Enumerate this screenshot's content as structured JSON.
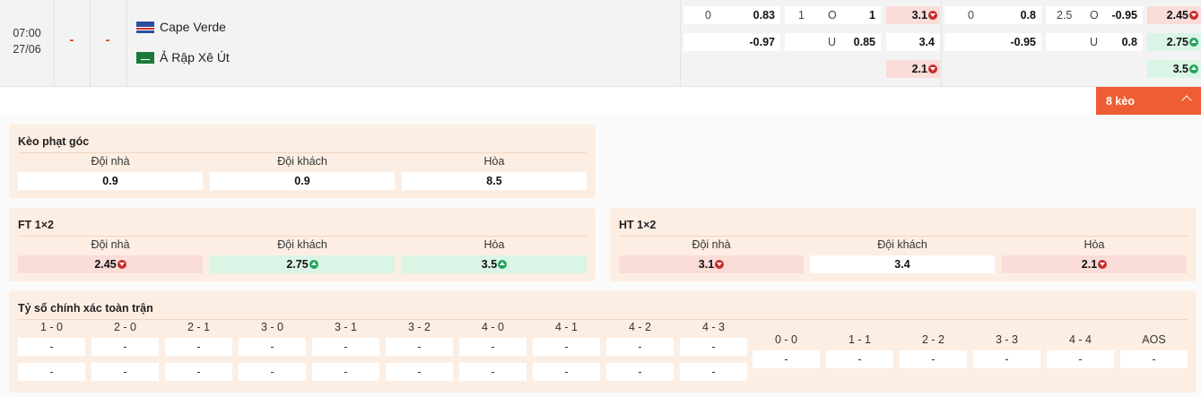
{
  "match": {
    "time": "07:00",
    "date": "27/06",
    "home_score": "-",
    "away_score": "-",
    "home_team": "Cape Verde",
    "away_team": "Ả Rập Xê Út"
  },
  "odds": {
    "ft_handicap": {
      "line": "0",
      "home": "0.83",
      "away": "-0.97"
    },
    "ft_ou": {
      "line": "1",
      "over_label": "O",
      "over": "1",
      "under_label": "U",
      "under": "0.85"
    },
    "ft_1x2": {
      "home": "3.1",
      "away": "3.4",
      "draw": "2.1"
    },
    "ht_handicap": {
      "line": "0",
      "home": "0.8",
      "away": "-0.95"
    },
    "ht_ou": {
      "line": "2.5",
      "over_label": "O",
      "over": "-0.95",
      "under_label": "U",
      "under": "0.8"
    },
    "ht_1x2": {
      "home": "2.45",
      "away": "2.75",
      "draw": "3.5"
    }
  },
  "more_button": {
    "label": "8 kèo"
  },
  "corner_card": {
    "title": "Kèo phạt góc",
    "columns": [
      "Đội nhà",
      "Đội khách",
      "Hòa"
    ],
    "values": [
      "0.9",
      "0.9",
      "8.5"
    ]
  },
  "ft_card": {
    "title": "FT 1×2",
    "columns": [
      "Đội nhà",
      "Đội khách",
      "Hòa"
    ],
    "values": [
      "2.45",
      "2.75",
      "3.5"
    ]
  },
  "ht_card": {
    "title": "HT 1×2",
    "columns": [
      "Đội nhà",
      "Đội khách",
      "Hòa"
    ],
    "values": [
      "3.1",
      "3.4",
      "2.1"
    ]
  },
  "score_card": {
    "title": "Tỷ số chính xác toàn trận",
    "home_scores": [
      "1 - 0",
      "2 - 0",
      "2 - 1",
      "3 - 0",
      "3 - 1",
      "3 - 2",
      "4 - 0",
      "4 - 1",
      "4 - 2",
      "4 - 3"
    ],
    "draw_scores": [
      "0 - 0",
      "1 - 1",
      "2 - 2",
      "3 - 3",
      "4 - 4",
      "AOS"
    ],
    "empty_value": "-"
  },
  "colors": {
    "accent": "#ee5d34",
    "card_bg": "#fdeee3",
    "down": "#c62d2d",
    "up": "#23a35a",
    "down_bg": "#fadcd8",
    "up_bg": "#daf5e6"
  },
  "icons": {
    "down": "arrow-down-circle-icon",
    "up": "arrow-up-circle-icon",
    "collapse": "chevron-up-icon"
  }
}
